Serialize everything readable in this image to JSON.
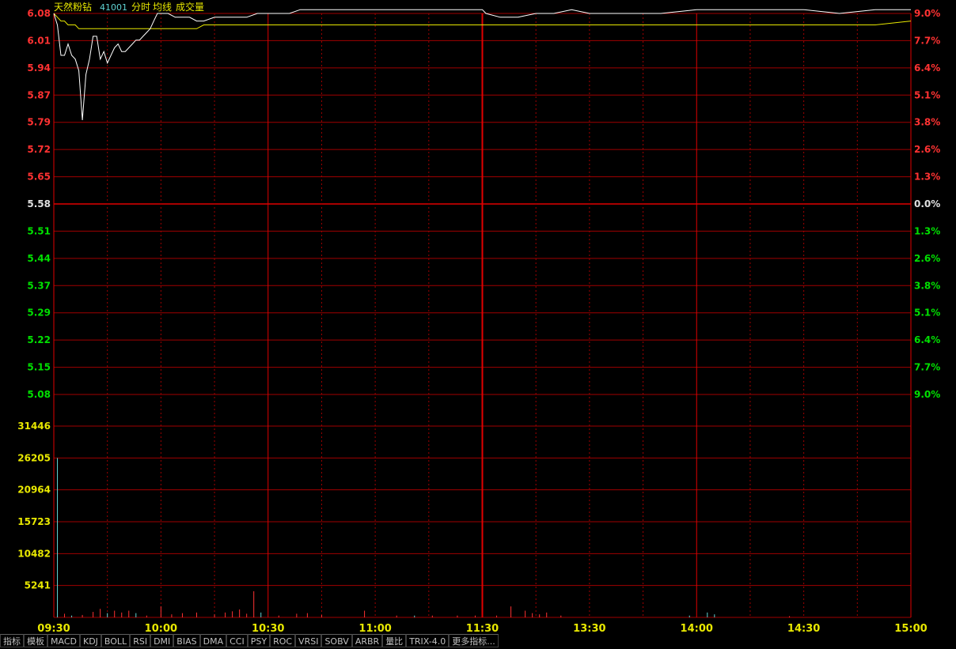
{
  "colors": {
    "background": "#000000",
    "grid": "#a00000",
    "grid_major": "#e00000",
    "up_label": "#ff3232",
    "down_label": "#00e000",
    "neutral_label": "#e0e0e0",
    "volume_label": "#e8e800",
    "price_line": "#ffffff",
    "avg_line": "#e8e800",
    "title_name": "#e8e800",
    "title_code": "#5fd3d3",
    "title_item": "#e8e800",
    "axis_time": "#e8e800"
  },
  "header": {
    "name": "天然粉钻",
    "code": "41001",
    "items": [
      "分时",
      "均线",
      "成交量"
    ]
  },
  "tabs": [
    "指标",
    "模板",
    "MACD",
    "KDJ",
    "BOLL",
    "RSI",
    "DMI",
    "BIAS",
    "DMA",
    "CCI",
    "PSY",
    "ROC",
    "VRSI",
    "SOBV",
    "ARBR",
    "量比",
    "TRIX-4.0",
    "更多指标..."
  ],
  "chart_data": [
    {
      "type": "line",
      "title": "",
      "x": [
        "09:30",
        "09:31",
        "09:32",
        "09:33",
        "09:34",
        "09:35",
        "09:36",
        "09:37",
        "09:38",
        "09:39",
        "09:40",
        "09:41",
        "09:42",
        "09:43",
        "09:44",
        "09:45",
        "09:46",
        "09:47",
        "09:48",
        "09:49",
        "09:50",
        "09:51",
        "09:52",
        "09:53",
        "09:54",
        "09:55",
        "09:56",
        "09:57",
        "09:58",
        "09:59",
        "10:00",
        "10:02",
        "10:04",
        "10:06",
        "10:08",
        "10:10",
        "10:12",
        "10:15",
        "10:18",
        "10:21",
        "10:24",
        "10:27",
        "10:30",
        "10:33",
        "10:36",
        "10:39",
        "10:42",
        "10:45",
        "10:50",
        "11:00",
        "11:10",
        "11:20",
        "11:30",
        "13:01",
        "13:05",
        "13:10",
        "13:15",
        "13:20",
        "13:25",
        "13:30",
        "13:40",
        "13:50",
        "14:00",
        "14:10",
        "14:20",
        "14:30",
        "14:40",
        "14:50",
        "15:00"
      ],
      "series": [
        {
          "values": [
            6.08,
            6.05,
            5.97,
            5.97,
            6.0,
            5.97,
            5.96,
            5.93,
            5.8,
            5.92,
            5.96,
            6.02,
            6.02,
            5.96,
            5.98,
            5.95,
            5.97,
            5.99,
            6.0,
            5.98,
            5.98,
            5.99,
            6.0,
            6.01,
            6.01,
            6.02,
            6.03,
            6.04,
            6.06,
            6.08,
            6.08,
            6.08,
            6.07,
            6.07,
            6.07,
            6.06,
            6.06,
            6.07,
            6.07,
            6.07,
            6.07,
            6.08,
            6.08,
            6.08,
            6.08,
            6.09,
            6.09,
            6.09,
            6.09,
            6.09,
            6.09,
            6.09,
            6.09,
            6.08,
            6.07,
            6.07,
            6.08,
            6.08,
            6.09,
            6.08,
            6.08,
            6.08,
            6.09,
            6.09,
            6.09,
            6.09,
            6.08,
            6.09,
            6.09
          ]
        },
        {
          "values": [
            6.08,
            6.07,
            6.06,
            6.06,
            6.05,
            6.05,
            6.05,
            6.04,
            6.04,
            6.04,
            6.04,
            6.04,
            6.04,
            6.04,
            6.04,
            6.04,
            6.04,
            6.04,
            6.04,
            6.04,
            6.04,
            6.04,
            6.04,
            6.04,
            6.04,
            6.04,
            6.04,
            6.04,
            6.04,
            6.04,
            6.04,
            6.04,
            6.04,
            6.04,
            6.04,
            6.04,
            6.05,
            6.05,
            6.05,
            6.05,
            6.05,
            6.05,
            6.05,
            6.05,
            6.05,
            6.05,
            6.05,
            6.05,
            6.05,
            6.05,
            6.05,
            6.05,
            6.05,
            6.05,
            6.05,
            6.05,
            6.05,
            6.05,
            6.05,
            6.05,
            6.05,
            6.05,
            6.05,
            6.05,
            6.05,
            6.05,
            6.05,
            6.05,
            6.06
          ]
        }
      ],
      "ylim": [
        5.08,
        6.08
      ],
      "y_ticks_left": [
        "6.08",
        "6.01",
        "5.94",
        "5.87",
        "5.79",
        "5.72",
        "5.65",
        "5.58",
        "5.51",
        "5.44",
        "5.37",
        "5.29",
        "5.22",
        "5.15",
        "5.08"
      ],
      "y_ticks_right": [
        "9.0%",
        "7.7%",
        "6.4%",
        "5.1%",
        "3.8%",
        "2.6%",
        "1.3%",
        "0.0%",
        "1.3%",
        "2.6%",
        "3.8%",
        "5.1%",
        "6.4%",
        "7.7%",
        "9.0%"
      ],
      "grid": true
    },
    {
      "type": "bar",
      "title": "",
      "ylim": [
        0,
        31446
      ],
      "y_ticks": [
        "31446",
        "26205",
        "20964",
        "15723",
        "10482",
        "5241"
      ],
      "x_ticks": [
        "09:30",
        "10:00",
        "10:30",
        "11:00",
        "11:30",
        "13:30",
        "14:00",
        "14:30",
        "15:00"
      ],
      "bars": [
        {
          "t": 1,
          "v": 26205,
          "c": "#5fd3d3"
        },
        {
          "t": 3,
          "v": 600,
          "c": "#ff3232"
        },
        {
          "t": 5,
          "v": 300,
          "c": "#5fd3d3"
        },
        {
          "t": 8,
          "v": 400,
          "c": "#ff3232"
        },
        {
          "t": 11,
          "v": 900,
          "c": "#ff3232"
        },
        {
          "t": 13,
          "v": 1400,
          "c": "#ff3232"
        },
        {
          "t": 15,
          "v": 700,
          "c": "#5fd3d3"
        },
        {
          "t": 17,
          "v": 1100,
          "c": "#ff3232"
        },
        {
          "t": 19,
          "v": 800,
          "c": "#ff3232"
        },
        {
          "t": 21,
          "v": 1100,
          "c": "#ff3232"
        },
        {
          "t": 23,
          "v": 700,
          "c": "#5fd3d3"
        },
        {
          "t": 26,
          "v": 300,
          "c": "#ff3232"
        },
        {
          "t": 30,
          "v": 1800,
          "c": "#ff3232"
        },
        {
          "t": 33,
          "v": 500,
          "c": "#ff3232"
        },
        {
          "t": 36,
          "v": 700,
          "c": "#ff3232"
        },
        {
          "t": 40,
          "v": 800,
          "c": "#ff3232"
        },
        {
          "t": 45,
          "v": 500,
          "c": "#ff3232"
        },
        {
          "t": 48,
          "v": 800,
          "c": "#ff3232"
        },
        {
          "t": 50,
          "v": 1000,
          "c": "#ff3232"
        },
        {
          "t": 52,
          "v": 1300,
          "c": "#ff3232"
        },
        {
          "t": 54,
          "v": 600,
          "c": "#ff3232"
        },
        {
          "t": 56,
          "v": 4300,
          "c": "#ff3232"
        },
        {
          "t": 58,
          "v": 800,
          "c": "#5fd3d3"
        },
        {
          "t": 63,
          "v": 300,
          "c": "#ff3232"
        },
        {
          "t": 68,
          "v": 600,
          "c": "#ff3232"
        },
        {
          "t": 71,
          "v": 700,
          "c": "#ff3232"
        },
        {
          "t": 75,
          "v": 400,
          "c": "#ff3232"
        },
        {
          "t": 87,
          "v": 1100,
          "c": "#ff3232"
        },
        {
          "t": 96,
          "v": 300,
          "c": "#ff3232"
        },
        {
          "t": 101,
          "v": 300,
          "c": "#5fd3d3"
        },
        {
          "t": 106,
          "v": 300,
          "c": "#ff3232"
        },
        {
          "t": 113,
          "v": 300,
          "c": "#ff3232"
        },
        {
          "t": 118,
          "v": 300,
          "c": "#ff3232"
        },
        {
          "t": 124,
          "v": 300,
          "c": "#ff3232"
        },
        {
          "t": 128,
          "v": 1800,
          "c": "#ff3232"
        },
        {
          "t": 132,
          "v": 1100,
          "c": "#ff3232"
        },
        {
          "t": 134,
          "v": 700,
          "c": "#ff3232"
        },
        {
          "t": 136,
          "v": 500,
          "c": "#ff3232"
        },
        {
          "t": 138,
          "v": 800,
          "c": "#ff3232"
        },
        {
          "t": 142,
          "v": 300,
          "c": "#ff3232"
        },
        {
          "t": 178,
          "v": 300,
          "c": "#5fd3d3"
        },
        {
          "t": 183,
          "v": 800,
          "c": "#5fd3d3"
        },
        {
          "t": 185,
          "v": 500,
          "c": "#5fd3d3"
        },
        {
          "t": 206,
          "v": 200,
          "c": "#ff3232"
        },
        {
          "t": 268,
          "v": 600,
          "c": "#ff3232"
        },
        {
          "t": 305,
          "v": 200,
          "c": "#5fd3d3"
        },
        {
          "t": 329,
          "v": 200,
          "c": "#5fd3d3"
        },
        {
          "t": 353,
          "v": 200,
          "c": "#5fd3d3"
        },
        {
          "t": 364,
          "v": 200,
          "c": "#ff3232"
        },
        {
          "t": 383,
          "v": 200,
          "c": "#5fd3d3"
        },
        {
          "t": 395,
          "v": 300,
          "c": "#5fd3d3"
        },
        {
          "t": 404,
          "v": 200,
          "c": "#5fd3d3"
        },
        {
          "t": 413,
          "v": 200,
          "c": "#5fd3d3"
        },
        {
          "t": 424,
          "v": 200,
          "c": "#5fd3d3"
        },
        {
          "t": 427,
          "v": 200,
          "c": "#5fd3d3"
        }
      ]
    }
  ]
}
